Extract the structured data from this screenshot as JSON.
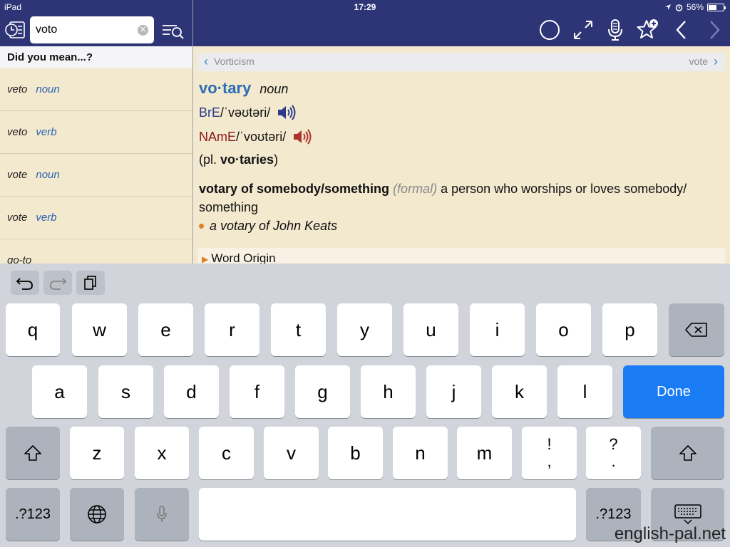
{
  "status": {
    "device": "iPad",
    "time": "17:29",
    "battery": "56%"
  },
  "search": {
    "value": "voto",
    "clear_icon": "clear-icon"
  },
  "left": {
    "heading": "Did you mean...?",
    "suggestions": [
      {
        "word": "veto",
        "pos": "noun"
      },
      {
        "word": "veto",
        "pos": "verb"
      },
      {
        "word": "vote",
        "pos": "noun"
      },
      {
        "word": "vote",
        "pos": "verb"
      },
      {
        "word": "go-to",
        "pos": ""
      }
    ]
  },
  "nav": {
    "prev": "Vorticism",
    "next": "vote"
  },
  "entry": {
    "headword": "vo·tary",
    "pos": "noun",
    "bre_label": "BrE",
    "bre_pron": "/ˈvəʊtəri/",
    "name_label": "NAmE",
    "name_pron": "/ˈvoʊtəri/",
    "plural_prefix": "(pl. ",
    "plural_form": "vo·taries",
    "plural_suffix": ")",
    "phrase": "votary of somebody/something",
    "register": "(formal)",
    "definition": " a person who worships or loves somebody/ something",
    "example": "a votary of John Keats",
    "word_origin": "Word Origin"
  },
  "keyboard": {
    "row1": [
      "q",
      "w",
      "e",
      "r",
      "t",
      "y",
      "u",
      "i",
      "o",
      "p"
    ],
    "row2": [
      "a",
      "s",
      "d",
      "f",
      "g",
      "h",
      "j",
      "k",
      "l"
    ],
    "row3": [
      "z",
      "x",
      "c",
      "v",
      "b",
      "n",
      "m"
    ],
    "punct1_top": "!",
    "punct1_bottom": ",",
    "punct2_top": "?",
    "punct2_bottom": ".",
    "done": "Done",
    "numbers": ".?123"
  },
  "watermark": "english-pal.net",
  "colors": {
    "bar": "#2e3577",
    "panel": "#f3e9cf",
    "link": "#2d6db3",
    "done": "#1a7cf5"
  }
}
